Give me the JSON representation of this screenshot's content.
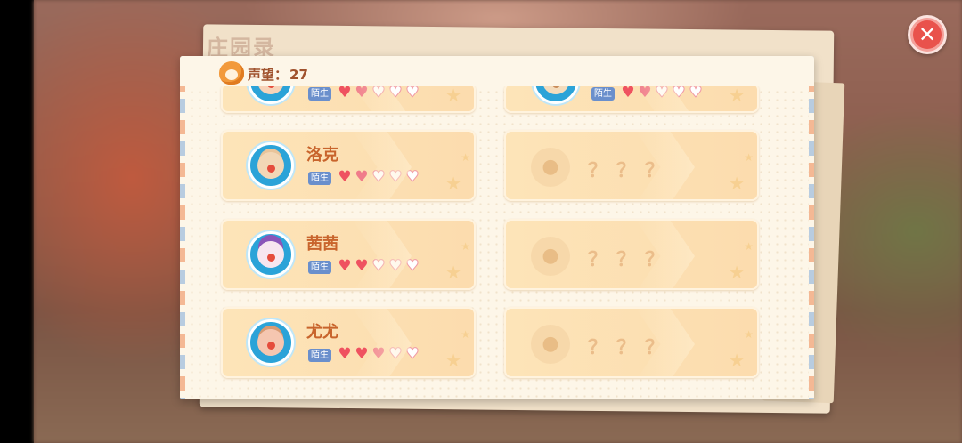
{
  "header": {
    "title": "庄园录"
  },
  "reputation": {
    "label": "声望：",
    "value": "27"
  },
  "close_icon": "close-icon",
  "colors": {
    "accent": "#c8642c",
    "badge": "#6a8fcc",
    "heart": "#ef5260",
    "close": "#e9524c"
  },
  "cards": [
    {
      "name": "",
      "relation": "陌生",
      "hearts": [
        "full",
        "half",
        "empty",
        "empty",
        "empty"
      ],
      "partial": true
    },
    {
      "name": "",
      "relation": "陌生",
      "hearts": [
        "full",
        "half",
        "empty",
        "empty",
        "empty"
      ],
      "partial": true
    },
    {
      "name": "洛克",
      "relation": "陌生",
      "hearts": [
        "full",
        "half",
        "empty",
        "empty",
        "empty"
      ]
    },
    {
      "locked_text": "？？？"
    },
    {
      "name": "茜茜",
      "relation": "陌生",
      "hearts": [
        "full",
        "full",
        "empty",
        "empty",
        "empty"
      ]
    },
    {
      "locked_text": "？？？"
    },
    {
      "name": "尤尤",
      "relation": "陌生",
      "hearts": [
        "full",
        "full",
        "half",
        "empty",
        "empty"
      ]
    },
    {
      "locked_text": "？？？"
    }
  ]
}
